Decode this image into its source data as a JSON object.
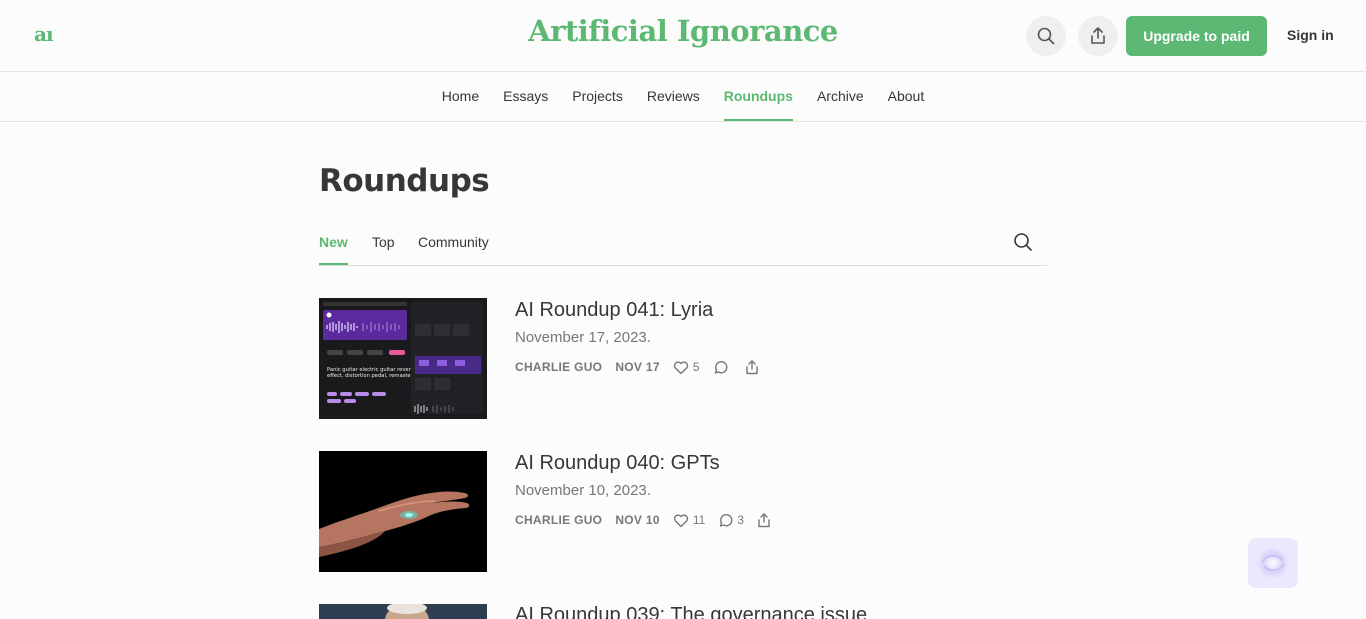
{
  "header": {
    "logo": "aı",
    "title": "Artificial Ignorance",
    "upgrade_label": "Upgrade to paid",
    "signin_label": "Sign in"
  },
  "nav": {
    "items": [
      {
        "label": "Home"
      },
      {
        "label": "Essays"
      },
      {
        "label": "Projects"
      },
      {
        "label": "Reviews"
      },
      {
        "label": "Roundups",
        "active": true
      },
      {
        "label": "Archive"
      },
      {
        "label": "About"
      }
    ]
  },
  "page": {
    "heading": "Roundups",
    "tabs": [
      {
        "label": "New",
        "active": true
      },
      {
        "label": "Top"
      },
      {
        "label": "Community"
      }
    ]
  },
  "posts": [
    {
      "title": "AI Roundup 041: Lyria",
      "subtitle": "November 17, 2023.",
      "author": "CHARLIE GUO",
      "date": "NOV 17",
      "likes": "5",
      "comments": ""
    },
    {
      "title": "AI Roundup 040: GPTs",
      "subtitle": "November 10, 2023.",
      "author": "CHARLIE GUO",
      "date": "NOV 10",
      "likes": "11",
      "comments": "3"
    },
    {
      "title": "AI Roundup 039: The governance issue"
    }
  ],
  "thumb1_text": "Panic guitar electric guitar reverb effect, distortion pedal, remastered",
  "colors": {
    "accent": "#5cb872",
    "text": "#363737",
    "muted": "#777777"
  }
}
